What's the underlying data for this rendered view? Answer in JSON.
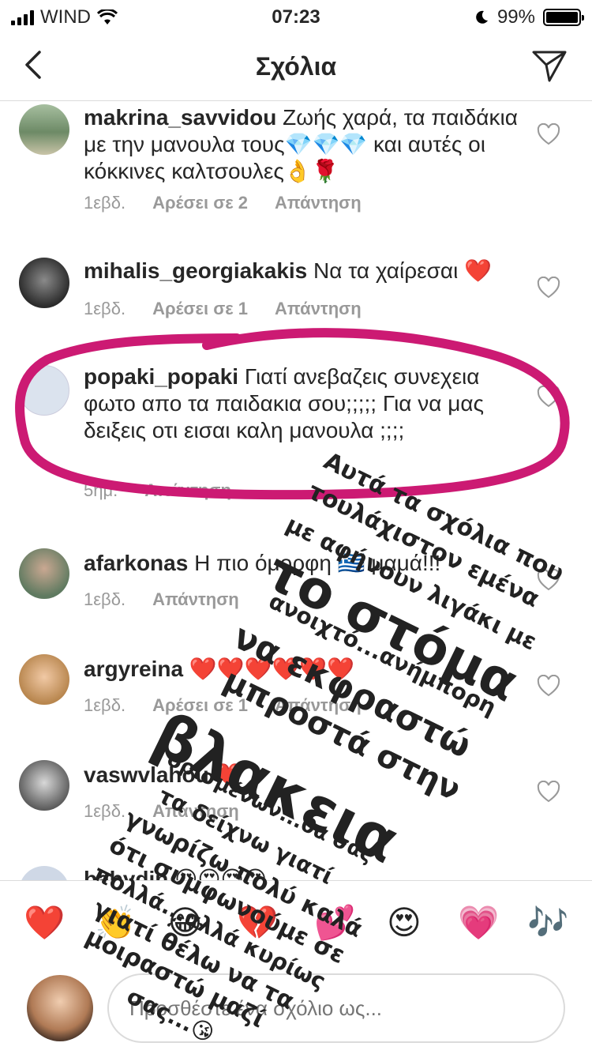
{
  "status": {
    "carrier": "WIND",
    "time": "07:23",
    "battery": "99%",
    "battery_level": 0.99
  },
  "nav": {
    "title": "Σχόλια"
  },
  "comments": [
    {
      "user": "makrina_savvidou",
      "text": "Ζωής χαρά, τα παιδάκια με την μανουλα τους💎💎💎 και αυτές οι κόκκινες καλτσουλες👌🌹",
      "age": "1εβδ.",
      "likes": "Αρέσει σε 2",
      "reply": "Απάντηση"
    },
    {
      "user": "mihalis_georgiakakis",
      "text": "Να τα χαίρεσαι ❤️",
      "age": "1εβδ.",
      "likes": "Αρέσει σε 1",
      "reply": "Απάντηση"
    },
    {
      "user": "popaki_popaki",
      "text": "Γιατί ανεβαζεις συνεχεια φωτο απο τα παιδακια σου;;;;; Για να μας δειξεις οτι εισαι καλη μανουλα ;;;;",
      "age": "5ημ.",
      "likes": "",
      "reply": "Απάντηση"
    },
    {
      "user": "afarkonas",
      "text": "Η πιο όμορφη 🇬🇷 μαμά!!!",
      "age": "1εβδ.",
      "likes": "",
      "reply": "Απάντηση"
    },
    {
      "user": "argyreina",
      "text": "❤️❤️❤️❤️❤️❤️",
      "age": "1εβδ.",
      "likes": "Αρέσει σε 1",
      "reply": "Απάντηση"
    },
    {
      "user": "vaswvlahou",
      "text": "❤️",
      "age": "1εβδ.",
      "likes": "",
      "reply": "Απάντηση"
    },
    {
      "user": "babydin",
      "text": "😍😍😍😍",
      "age": "",
      "likes": "",
      "reply": ""
    }
  ],
  "emoji_bar": [
    "❤️",
    "👏",
    "😂",
    "💔",
    "💕",
    "😍",
    "💗",
    "🎶"
  ],
  "input": {
    "placeholder": "Προσθέστε ένα σχόλιο ως..."
  },
  "overlay": {
    "line1": "Αυτά τα σχόλια που",
    "line2": "τουλάχιστον εμένα",
    "line3": "με αφήνουν λιγάκι με",
    "line4": "το στόμα",
    "line5": "ανοιχτό...ανήμπορη",
    "line6": "να εκφραστώ",
    "line7": "μπροστά στην",
    "line8": "βλακεια",
    "line9": "ορισμένων...θα σας",
    "line10": "τα δείχνω γιατί",
    "line11": "γνωρίζω πολύ καλά",
    "line12": "ότι συμφωνούμε σε",
    "line13": "πολλά...αλλά κυρίως",
    "line14": "γιατί θέλω να τα",
    "line15": "μοιραστώ μαζί",
    "line16": "σας...😘"
  },
  "colors": {
    "highlight": "#cc1a73",
    "muted": "#999999"
  }
}
